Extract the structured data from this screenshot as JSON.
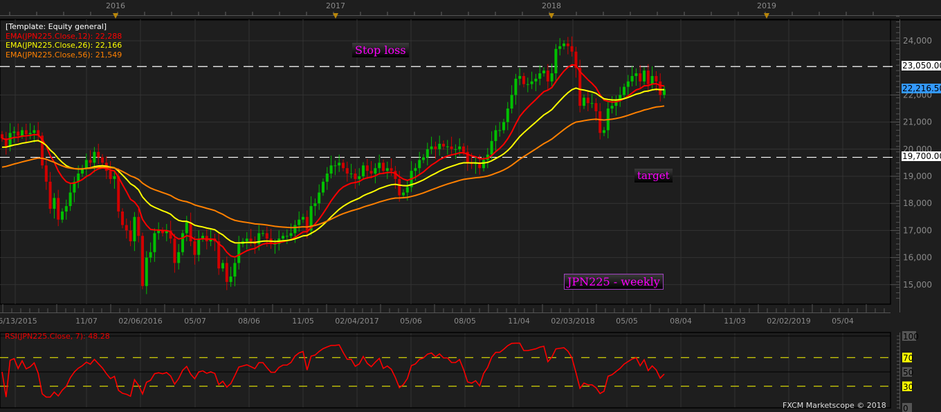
{
  "legend": {
    "template": "[Template: Equity general]",
    "ema12": "EMA(JPN225.Close,12): 22,288",
    "ema26": "EMA(JPN225.Close,26): 22,166",
    "ema56": "EMA(JPN225.Close,56): 21,549"
  },
  "annotations": {
    "stop_loss": "Stop loss",
    "target": "target",
    "title": "JPN225 - weekly"
  },
  "price_tags": {
    "stop_loss": "23,050.00",
    "current": "22,216.50",
    "target": "19,700.00"
  },
  "rsi": {
    "title": "RSI(JPN225.Close, 7): 48.28",
    "labels": [
      "100",
      "70",
      "50",
      "30",
      "0"
    ]
  },
  "copyright": "FXCM Marketscope © 2018",
  "colors": {
    "ema12": "#ff0000",
    "ema26": "#ffff00",
    "ema56": "#ff8000",
    "up": "#00c000",
    "down": "#d00000",
    "current": "#3399ff"
  },
  "chart_data": {
    "type": "candlestick",
    "title": "JPN225 - weekly",
    "years": [
      "2016",
      "2017",
      "2018",
      "2019"
    ],
    "date_ticks": [
      "06/13/2015",
      "11/07",
      "02/06/2016",
      "05/07",
      "08/06",
      "11/05",
      "02/04/2017",
      "05/06",
      "08/05",
      "11/04",
      "02/03/2018",
      "05/05",
      "08/04",
      "11/03",
      "02/02/2019",
      "05/04"
    ],
    "y_ticks": [
      "24,000",
      "22,000",
      "21,000",
      "20,000",
      "19,000",
      "18,000",
      "17,000",
      "16,000",
      "15,000"
    ],
    "ylim": [
      14300,
      24900
    ],
    "hlines": [
      23050,
      19700
    ],
    "closes": [
      20400,
      20100,
      20600,
      20650,
      20500,
      20700,
      20550,
      20600,
      20700,
      20500,
      19400,
      18800,
      17800,
      18200,
      17400,
      17700,
      17900,
      18400,
      18800,
      19100,
      19300,
      19600,
      19500,
      19900,
      19700,
      19500,
      19200,
      18900,
      19000,
      17700,
      17200,
      17000,
      16600,
      17500,
      16800,
      14950,
      16000,
      16200,
      16900,
      17000,
      16900,
      17000,
      16700,
      15800,
      16200,
      16900,
      17300,
      16600,
      16100,
      16700,
      16800,
      16600,
      16700,
      16600,
      15600,
      15800,
      15100,
      15300,
      15800,
      16500,
      16600,
      16700,
      16600,
      16500,
      16900,
      16900,
      16700,
      16500,
      16500,
      16700,
      16800,
      16800,
      16900,
      17200,
      17400,
      17500,
      17000,
      17900,
      18000,
      18400,
      18800,
      19100,
      19400,
      19400,
      19500,
      19300,
      19100,
      19100,
      18900,
      19000,
      19400,
      19200,
      19100,
      19300,
      19500,
      19200,
      19300,
      19200,
      18900,
      18300,
      18400,
      18600,
      19200,
      19300,
      19600,
      19700,
      20000,
      20100,
      20000,
      20200,
      20100,
      20100,
      20000,
      20000,
      20100,
      19900,
      19500,
      19450,
      19500,
      19300,
      19600,
      19800,
      20300,
      20700,
      20700,
      21000,
      21500,
      22000,
      22600,
      22700,
      22400,
      22400,
      22500,
      22600,
      22800,
      22900,
      22500,
      22800,
      23700,
      23800,
      23900,
      23800,
      23600,
      23000,
      21600,
      21900,
      21700,
      21700,
      21400,
      20600,
      20700,
      21500,
      21600,
      21800,
      22000,
      22300,
      22500,
      22700,
      22800,
      22500,
      22900,
      22400,
      22700,
      22500,
      22000,
      22216.5
    ],
    "ema_periods": [
      12,
      26,
      56
    ],
    "rsi_period": 7,
    "rsi_levels": [
      70,
      50,
      30
    ]
  }
}
